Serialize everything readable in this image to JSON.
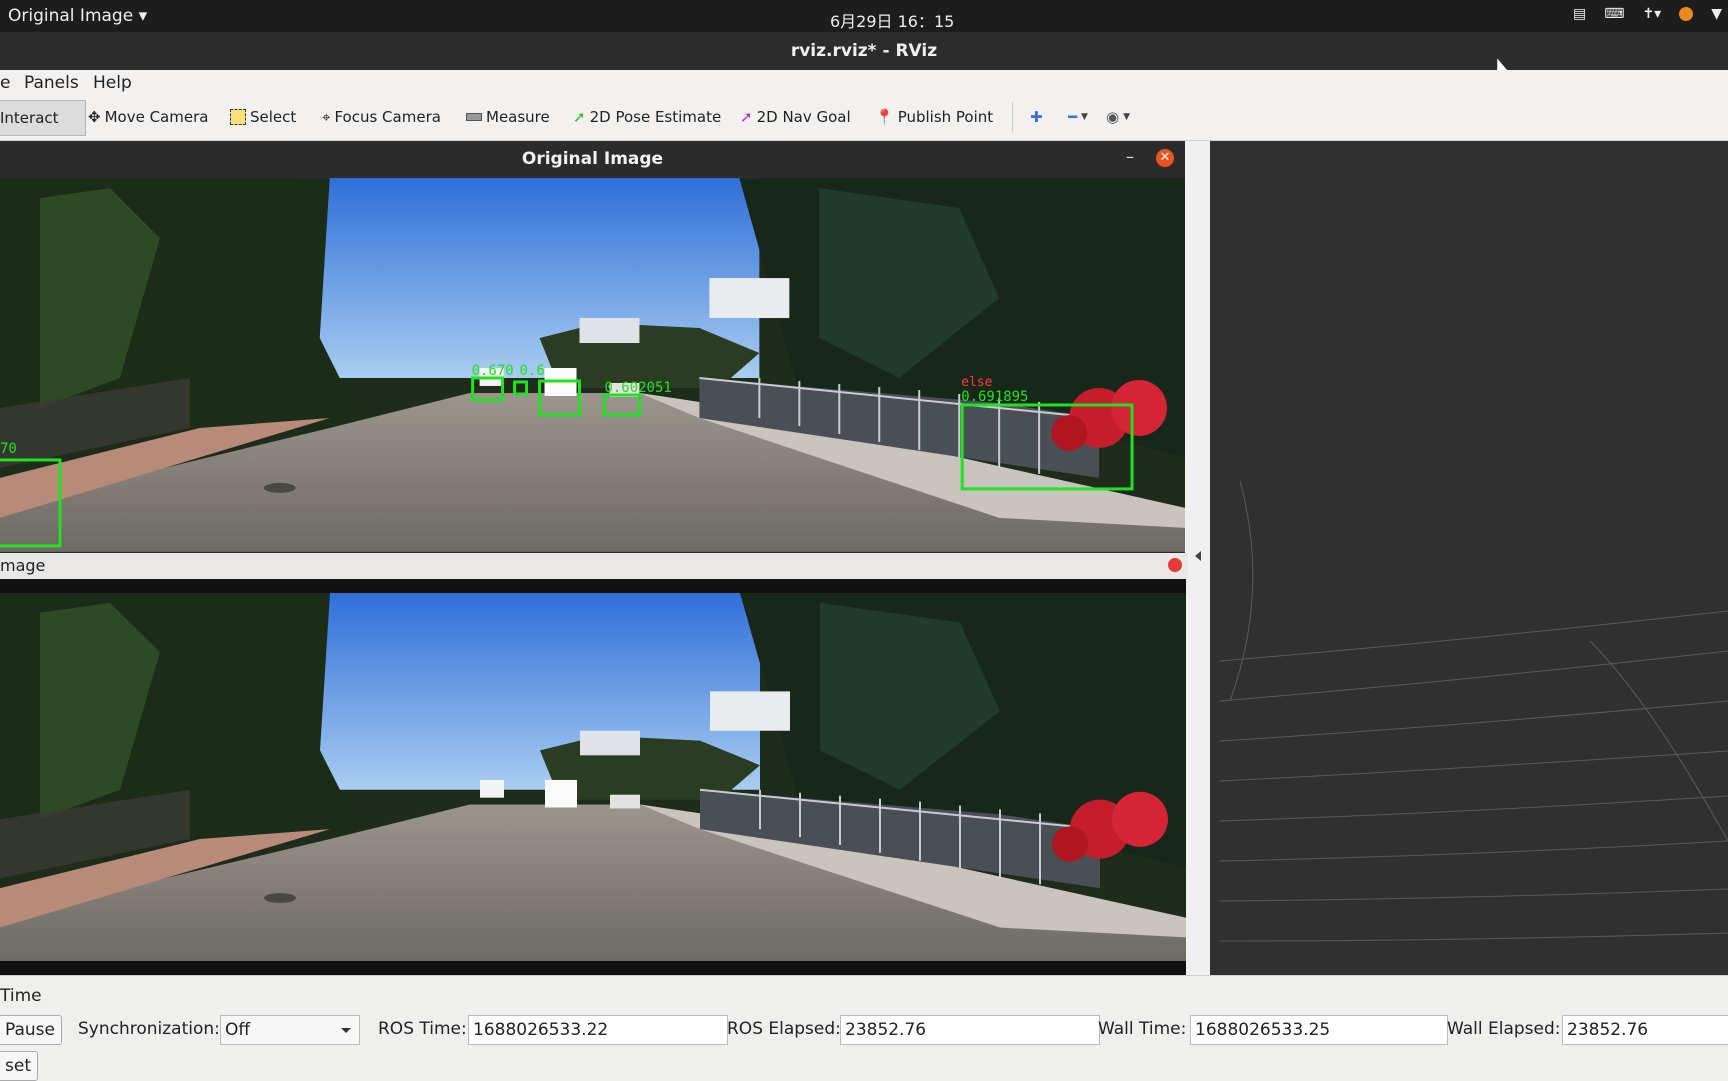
{
  "system_bar": {
    "app_menu": "Original Image",
    "clock": "6月29日  16：15"
  },
  "window": {
    "title": "rviz.rviz* - RViz"
  },
  "menu": {
    "items": [
      "e",
      "Panels",
      "Help"
    ]
  },
  "toolbar": {
    "tools": [
      {
        "label": "Interact"
      },
      {
        "label": "Move Camera"
      },
      {
        "label": "Select"
      },
      {
        "label": "Focus Camera"
      },
      {
        "label": "Measure"
      },
      {
        "label": "2D Pose Estimate"
      },
      {
        "label": "2D Nav Goal"
      },
      {
        "label": "Publish Point"
      }
    ]
  },
  "panels": {
    "original_image": {
      "title": "Original Image"
    },
    "lower_image": {
      "label": "mage"
    }
  },
  "detections": {
    "labels": [
      "0.670",
      "0.6",
      "0.602051",
      "else",
      "0.691895",
      "70"
    ]
  },
  "time_panel": {
    "title": "Time",
    "pause_label": "Pause",
    "reset_label": "set",
    "sync_label": "Synchronization:",
    "sync_value": "Off",
    "ros_time_label": "ROS Time:",
    "ros_time": "1688026533.22",
    "ros_elapsed_label": "ROS Elapsed:",
    "ros_elapsed": "23852.76",
    "wall_time_label": "Wall Time:",
    "wall_time": "1688026533.25",
    "wall_elapsed_label": "Wall Elapsed:",
    "wall_elapsed": "23852.76"
  },
  "colors": {
    "detection_box": "#22e022",
    "detection_class_label": "#ff3b3b",
    "close_button": "#e95420"
  }
}
